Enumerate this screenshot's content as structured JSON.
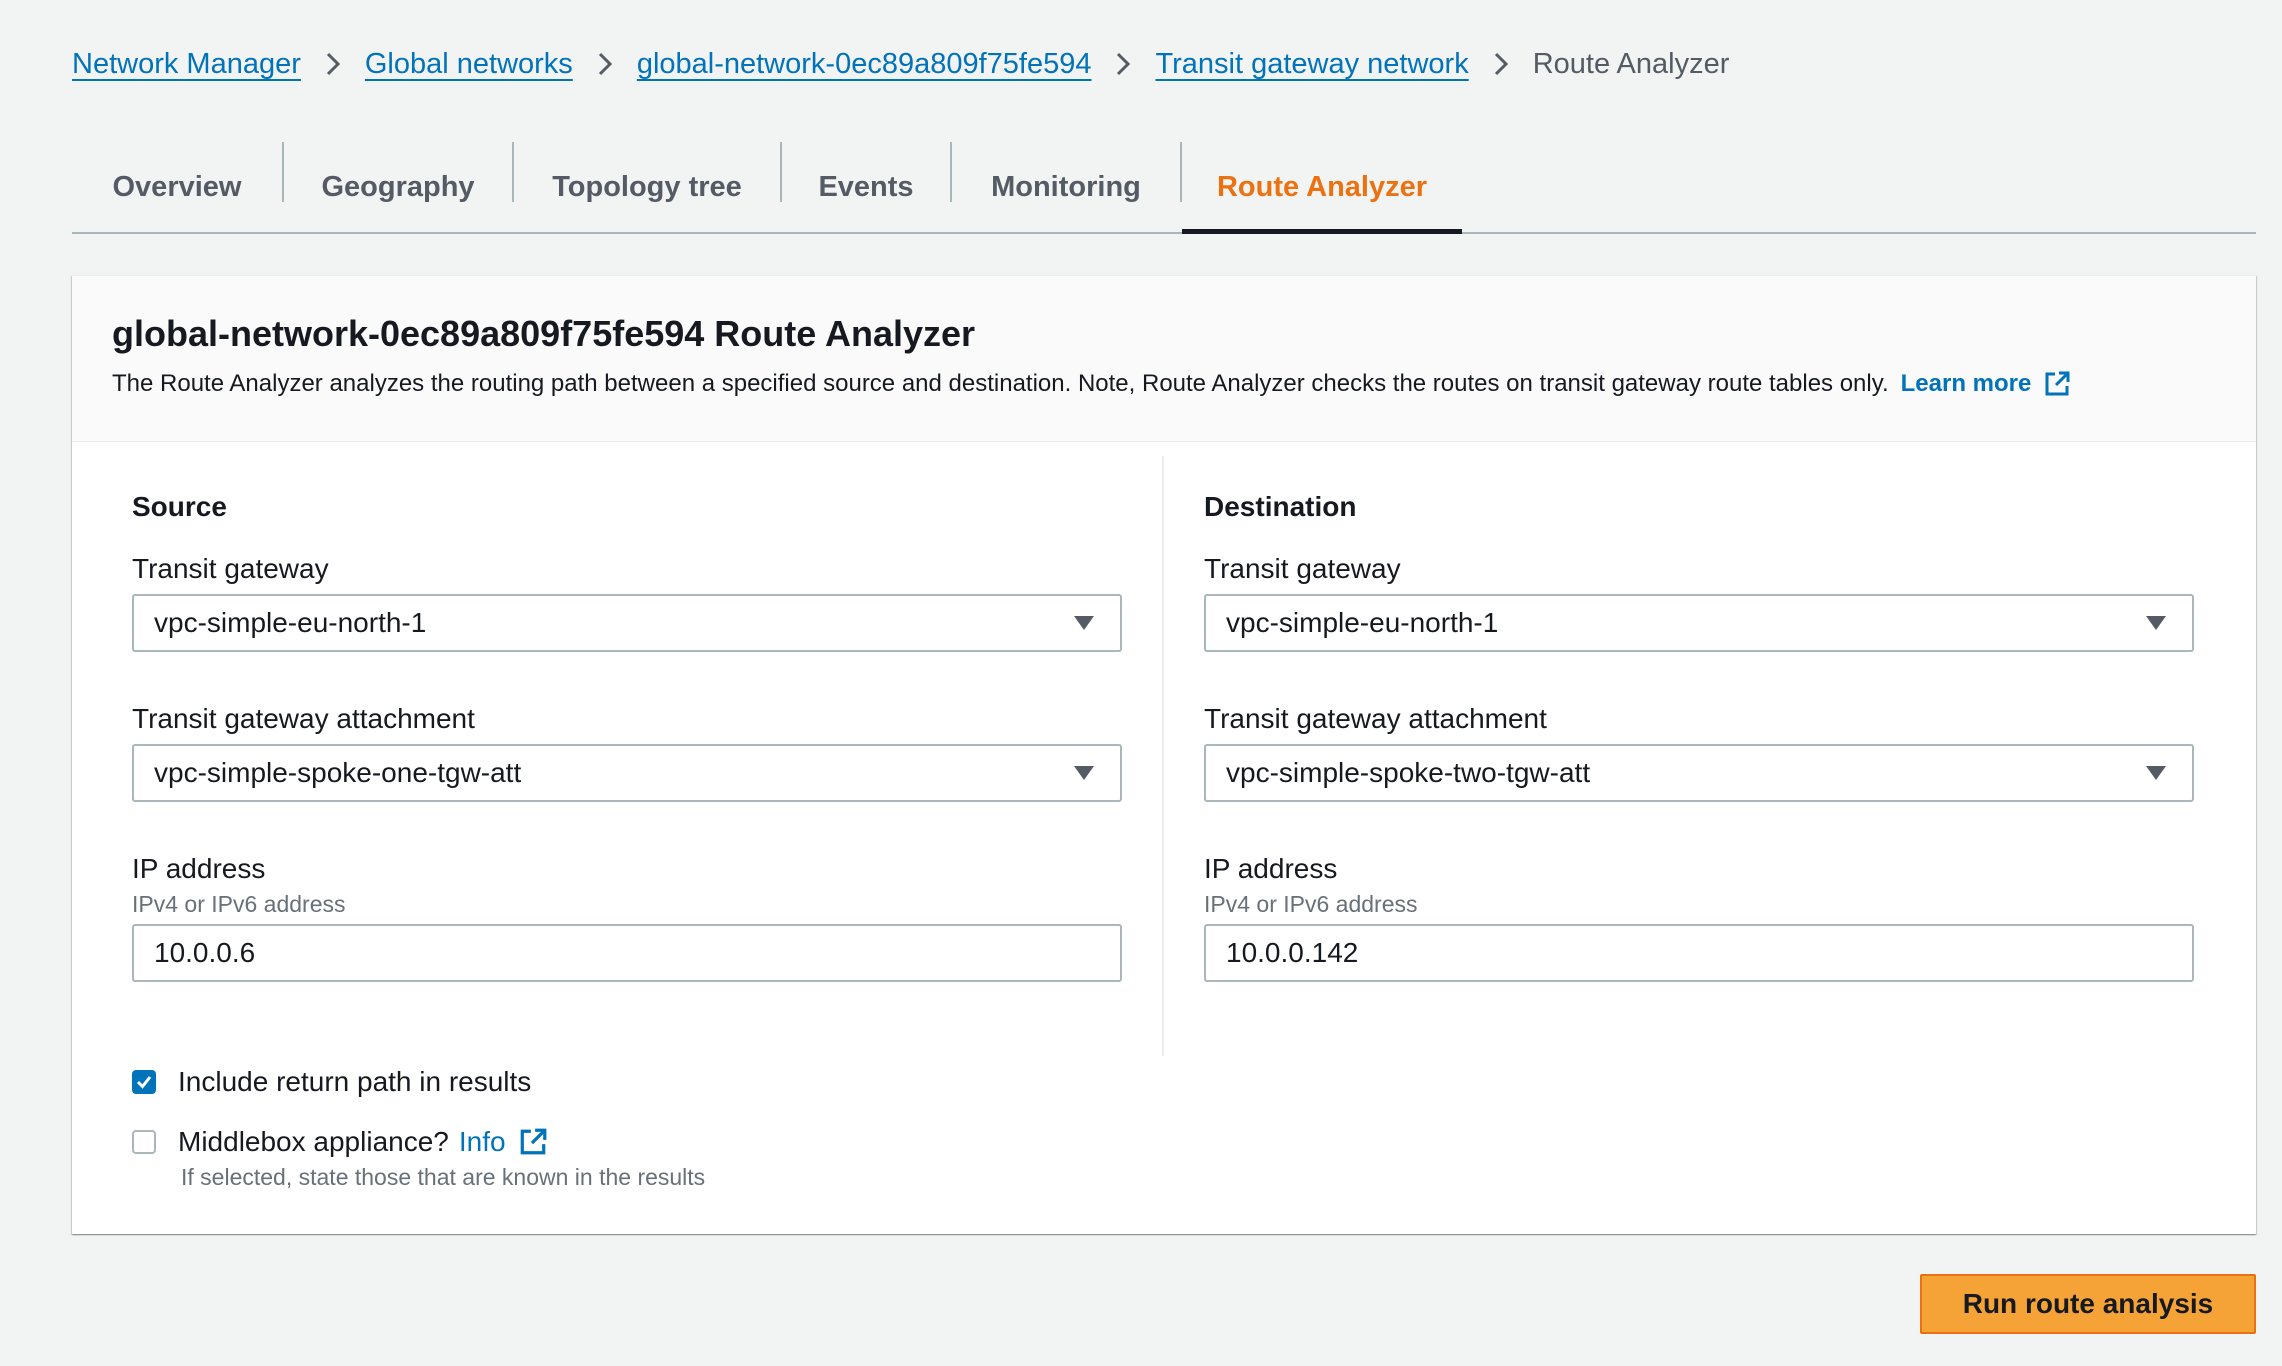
{
  "breadcrumb": {
    "items": [
      {
        "label": "Network Manager"
      },
      {
        "label": "Global networks"
      },
      {
        "label": "global-network-0ec89a809f75fe594"
      },
      {
        "label": "Transit gateway network"
      }
    ],
    "current": "Route Analyzer"
  },
  "tabs": [
    {
      "label": "Overview"
    },
    {
      "label": "Geography"
    },
    {
      "label": "Topology tree"
    },
    {
      "label": "Events"
    },
    {
      "label": "Monitoring"
    },
    {
      "label": "Route Analyzer",
      "active": true
    }
  ],
  "panel": {
    "title": "global-network-0ec89a809f75fe594 Route Analyzer",
    "description": "The Route Analyzer analyzes the routing path between a specified source and destination. Note, Route Analyzer checks the routes on transit gateway route tables only.",
    "learn_more": "Learn more"
  },
  "source": {
    "heading": "Source",
    "tgw_label": "Transit gateway",
    "tgw_value": "vpc-simple-eu-north-1",
    "attachment_label": "Transit gateway attachment",
    "attachment_value": "vpc-simple-spoke-one-tgw-att",
    "ip_label": "IP address",
    "ip_hint": "IPv4 or IPv6 address",
    "ip_value": "10.0.0.6"
  },
  "destination": {
    "heading": "Destination",
    "tgw_label": "Transit gateway",
    "tgw_value": "vpc-simple-eu-north-1",
    "attachment_label": "Transit gateway attachment",
    "attachment_value": "vpc-simple-spoke-two-tgw-att",
    "ip_label": "IP address",
    "ip_hint": "IPv4 or IPv6 address",
    "ip_value": "10.0.0.142"
  },
  "options": {
    "return_path_label": "Include return path in results",
    "return_path_checked": true,
    "middlebox_label": "Middlebox appliance?",
    "middlebox_checked": false,
    "middlebox_info": "Info",
    "middlebox_hint": "If selected, state those that are known in the results"
  },
  "actions": {
    "run_label": "Run route analysis"
  },
  "colors": {
    "link": "#0073bb",
    "active_tab": "#ec7211",
    "primary_button": "#f5a336",
    "checkbox_checked": "#0073bb"
  },
  "icons": {
    "breadcrumb_separator": "chevron-right-icon",
    "external_link": "external-link-icon",
    "select_caret": "caret-down-icon",
    "check": "check-icon"
  }
}
